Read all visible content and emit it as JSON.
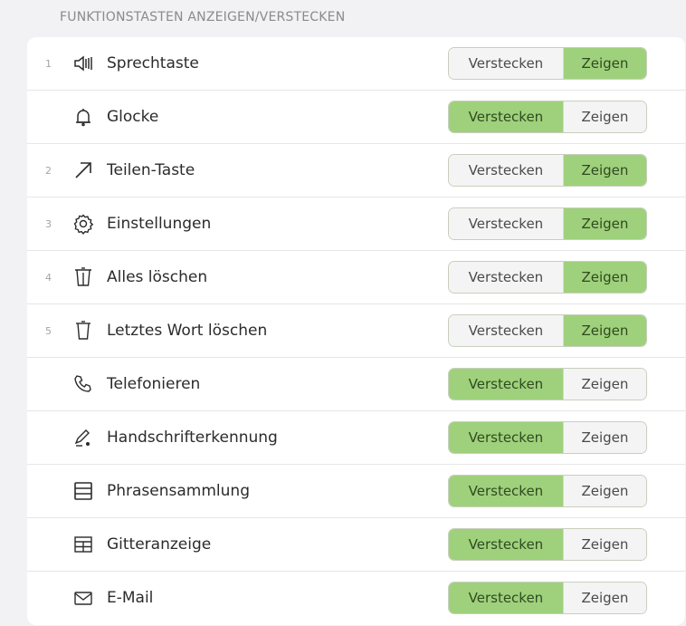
{
  "section_title": "FUNKTIONSTASTEN ANZEIGEN/VERSTECKEN",
  "toggle_labels": {
    "hide": "Verstecken",
    "show": "Zeigen"
  },
  "accent_color": "#9fd17c",
  "rows": [
    {
      "index": "1",
      "icon": "speaker-icon",
      "label": "Sprechtaste",
      "selected": "show"
    },
    {
      "index": "",
      "icon": "bell-icon",
      "label": "Glocke",
      "selected": "hide"
    },
    {
      "index": "2",
      "icon": "share-arrow-icon",
      "label": "Teilen-Taste",
      "selected": "show"
    },
    {
      "index": "3",
      "icon": "gear-icon",
      "label": "Einstellungen",
      "selected": "show"
    },
    {
      "index": "4",
      "icon": "trash-double-icon",
      "label": "Alles löschen",
      "selected": "show"
    },
    {
      "index": "5",
      "icon": "trash-icon",
      "label": "Letztes Wort löschen",
      "selected": "show"
    },
    {
      "index": "",
      "icon": "phone-icon",
      "label": "Telefonieren",
      "selected": "hide"
    },
    {
      "index": "",
      "icon": "handwriting-icon",
      "label": "Handschrifterkennung",
      "selected": "hide"
    },
    {
      "index": "",
      "icon": "phrase-collection-icon",
      "label": "Phrasensammlung",
      "selected": "hide"
    },
    {
      "index": "",
      "icon": "grid-icon",
      "label": "Gitteranzeige",
      "selected": "hide"
    },
    {
      "index": "",
      "icon": "mail-icon",
      "label": "E-Mail",
      "selected": "hide"
    }
  ]
}
